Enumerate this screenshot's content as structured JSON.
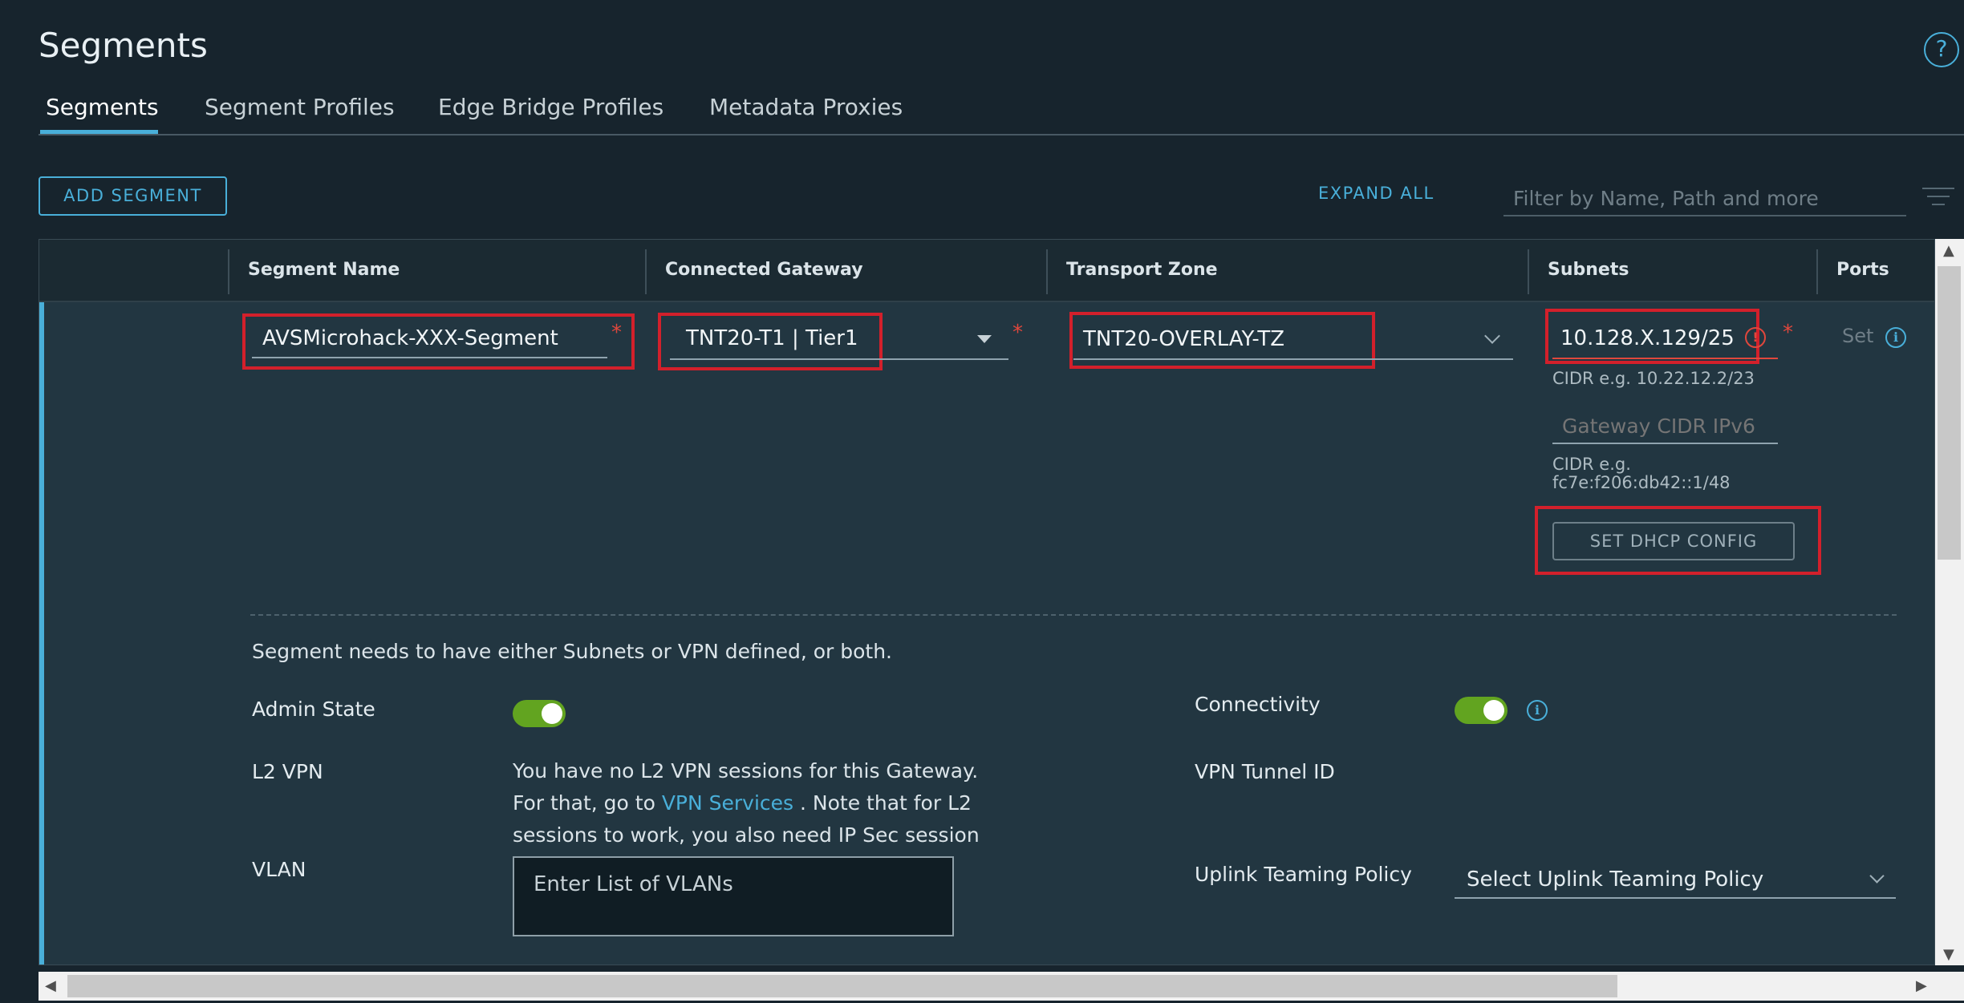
{
  "header": {
    "title": "Segments",
    "help_icon": "?"
  },
  "tabs": [
    {
      "label": "Segments",
      "active": true
    },
    {
      "label": "Segment Profiles",
      "active": false
    },
    {
      "label": "Edge Bridge Profiles",
      "active": false
    },
    {
      "label": "Metadata Proxies",
      "active": false
    }
  ],
  "toolbar": {
    "add_segment": "ADD SEGMENT",
    "expand_all": "EXPAND ALL",
    "filter_placeholder": "Filter by Name, Path and more"
  },
  "grid": {
    "columns": [
      "Segment Name",
      "Connected Gateway",
      "Transport Zone",
      "Subnets",
      "Ports"
    ],
    "row": {
      "segment_name": "AVSMicrohack-XXX-Segment",
      "connected_gateway": "TNT20-T1 | Tier1",
      "transport_zone": "TNT20-OVERLAY-TZ",
      "subnet": "10.128.X.129/25",
      "subnet_hint": "CIDR e.g. 10.22.12.2/23",
      "gateway_cidr_ipv6_placeholder": "Gateway CIDR IPv6",
      "ipv6_hint_line1": "CIDR e.g.",
      "ipv6_hint_line2": "fc7e:f206:db42::1/48",
      "dhcp_button": "SET DHCP CONFIG",
      "ports_set": "Set",
      "required_mark": "*",
      "error_mark": "!",
      "info_mark": "i"
    },
    "details": {
      "notice": "Segment needs to have either Subnets or VPN defined, or both.",
      "admin_state_label": "Admin State",
      "admin_state_on": true,
      "connectivity_label": "Connectivity",
      "connectivity_on": true,
      "l2vpn_label": "L2 VPN",
      "l2vpn_line1": "You have no L2 VPN sessions for this Gateway.",
      "l2vpn_line2_pre": "For that, go to ",
      "l2vpn_link": "VPN Services",
      "l2vpn_line2_post": " . Note that for L2",
      "l2vpn_line3": "sessions to work, you also need IP Sec session",
      "vpn_tunnel_label": "VPN Tunnel ID",
      "vlan_label": "VLAN",
      "vlan_placeholder": "Enter List of VLANs",
      "uplink_label": "Uplink Teaming Policy",
      "uplink_placeholder": "Select Uplink Teaming Policy"
    }
  },
  "colors": {
    "accent": "#49afd9",
    "highlight": "#d3202b",
    "toggle_on": "#62a420",
    "background": "#17242d"
  }
}
